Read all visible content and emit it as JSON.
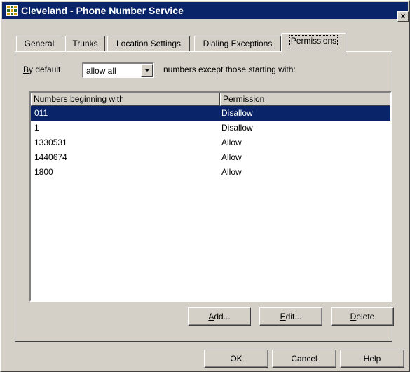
{
  "window": {
    "title": "Cleveland - Phone Number Service",
    "close_label": "×"
  },
  "tabs": [
    {
      "label": "General"
    },
    {
      "label": "Trunks"
    },
    {
      "label": "Location Settings"
    },
    {
      "label": "Dialing Exceptions"
    },
    {
      "label": "Permissions"
    }
  ],
  "active_tab": "Permissions",
  "permissions": {
    "default_label_prefix": "B",
    "default_label_rest": "y default",
    "default_value": "allow all",
    "after_label": "numbers except those starting with:",
    "columns": [
      "Numbers beginning with",
      "Permission"
    ],
    "rows": [
      {
        "number": "011",
        "permission": "Disallow",
        "selected": true
      },
      {
        "number": "1",
        "permission": "Disallow",
        "selected": false
      },
      {
        "number": "1330531",
        "permission": "Allow",
        "selected": false
      },
      {
        "number": "1440674",
        "permission": "Allow",
        "selected": false
      },
      {
        "number": "1800",
        "permission": "Allow",
        "selected": false
      }
    ],
    "add_key": "A",
    "add_rest": "dd...",
    "edit_key": "E",
    "edit_rest": "dit...",
    "delete_key": "D",
    "delete_rest": "elete"
  },
  "footer": {
    "ok_label": "OK",
    "cancel_label": "Cancel",
    "help_label": "Help"
  },
  "colors": {
    "face": "#d4d0c8",
    "title_bar": "#0a246a",
    "selection": "#0a246a"
  }
}
